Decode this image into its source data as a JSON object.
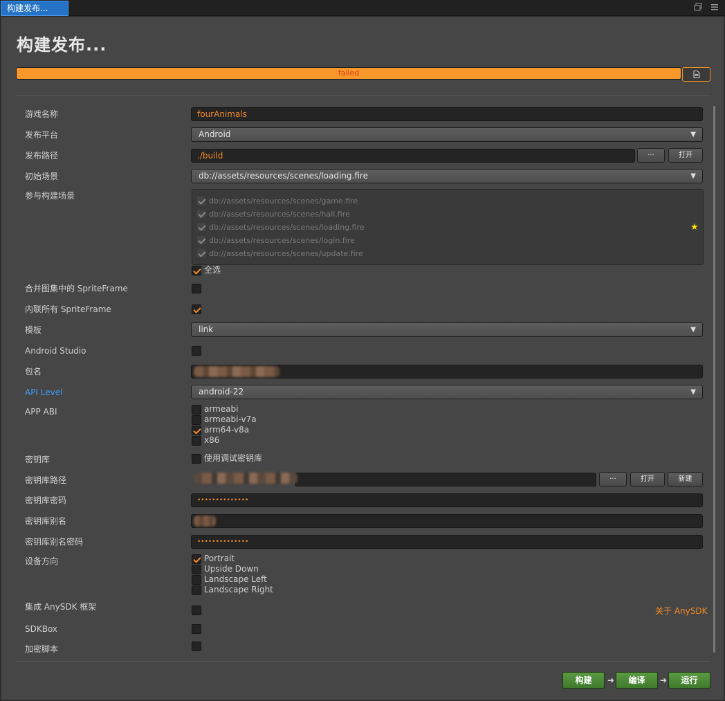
{
  "window": {
    "tab_label": "构建发布...",
    "restore_icon": "restore-window-icon",
    "menu_icon": "hamburger-menu-icon"
  },
  "header": {
    "title": "构建发布...",
    "progress": {
      "status": "failed",
      "percent": 100
    },
    "log_button_icon": "log-file-icon"
  },
  "colors": {
    "accent": "#f58b27",
    "progress": "#f8982b",
    "failed_text": "#e13a1f",
    "link_blue": "#3f9ef7",
    "green_button": "#4a8a35"
  },
  "form": {
    "game_name": {
      "label": "游戏名称",
      "value": "fourAnimals"
    },
    "platform": {
      "label": "发布平台",
      "value": "Android"
    },
    "build_path": {
      "label": "发布路径",
      "value": "./build",
      "browse": "···",
      "open": "打开"
    },
    "start_scene": {
      "label": "初始场景",
      "value": "db://assets/resources/scenes/loading.fire"
    },
    "scenes": {
      "label": "参与构建场景",
      "items": [
        "db://assets/resources/scenes/game.fire",
        "db://assets/resources/scenes/hall.fire",
        "db://assets/resources/scenes/loading.fire",
        "db://assets/resources/scenes/login.fire",
        "db://assets/resources/scenes/update.fire"
      ],
      "select_all": "全选"
    },
    "merge_sprite": {
      "label": "合并图集中的 SpriteFrame",
      "checked": false
    },
    "inline_sprite": {
      "label": "内联所有 SpriteFrame",
      "checked": true
    },
    "template": {
      "label": "模板",
      "value": "link"
    },
    "android_studio": {
      "label": "Android Studio",
      "checked": false
    },
    "package_name": {
      "label": "包名",
      "value": ""
    },
    "api_level": {
      "label": "API Level",
      "value": "android-22"
    },
    "app_abi": {
      "label": "APP ABI",
      "options": [
        "armeabi",
        "armeabi-v7a",
        "arm64-v8a",
        "x86"
      ],
      "checked": [
        false,
        false,
        true,
        false
      ]
    },
    "keystore": {
      "label": "密钥库",
      "option": "使用调试密钥库",
      "checked": false
    },
    "keystore_path": {
      "label": "密钥库路径",
      "value": "",
      "browse": "···",
      "open": "打开",
      "new": "新建"
    },
    "keystore_password": {
      "label": "密钥库密码",
      "value": "••••••••••••••"
    },
    "keystore_alias": {
      "label": "密钥库别名",
      "value": ""
    },
    "alias_password": {
      "label": "密钥库别名密码",
      "value": "••••••••••••••"
    },
    "orientation": {
      "label": "设备方向",
      "options": [
        "Portrait",
        "Upside Down",
        "Landscape Left",
        "Landscape Right"
      ],
      "checked": [
        true,
        false,
        false,
        false
      ]
    },
    "anysdk": {
      "label": "集成 AnySDK 框架",
      "checked": false,
      "link": "关于 AnySDK"
    },
    "sdkbox": {
      "label": "SDKBox",
      "checked": false
    },
    "encrypt": {
      "label": "加密脚本",
      "checked": false
    }
  },
  "footer": {
    "build": "构建",
    "compile": "编译",
    "run": "运行",
    "arrow_icon": "step-arrow-icon"
  }
}
